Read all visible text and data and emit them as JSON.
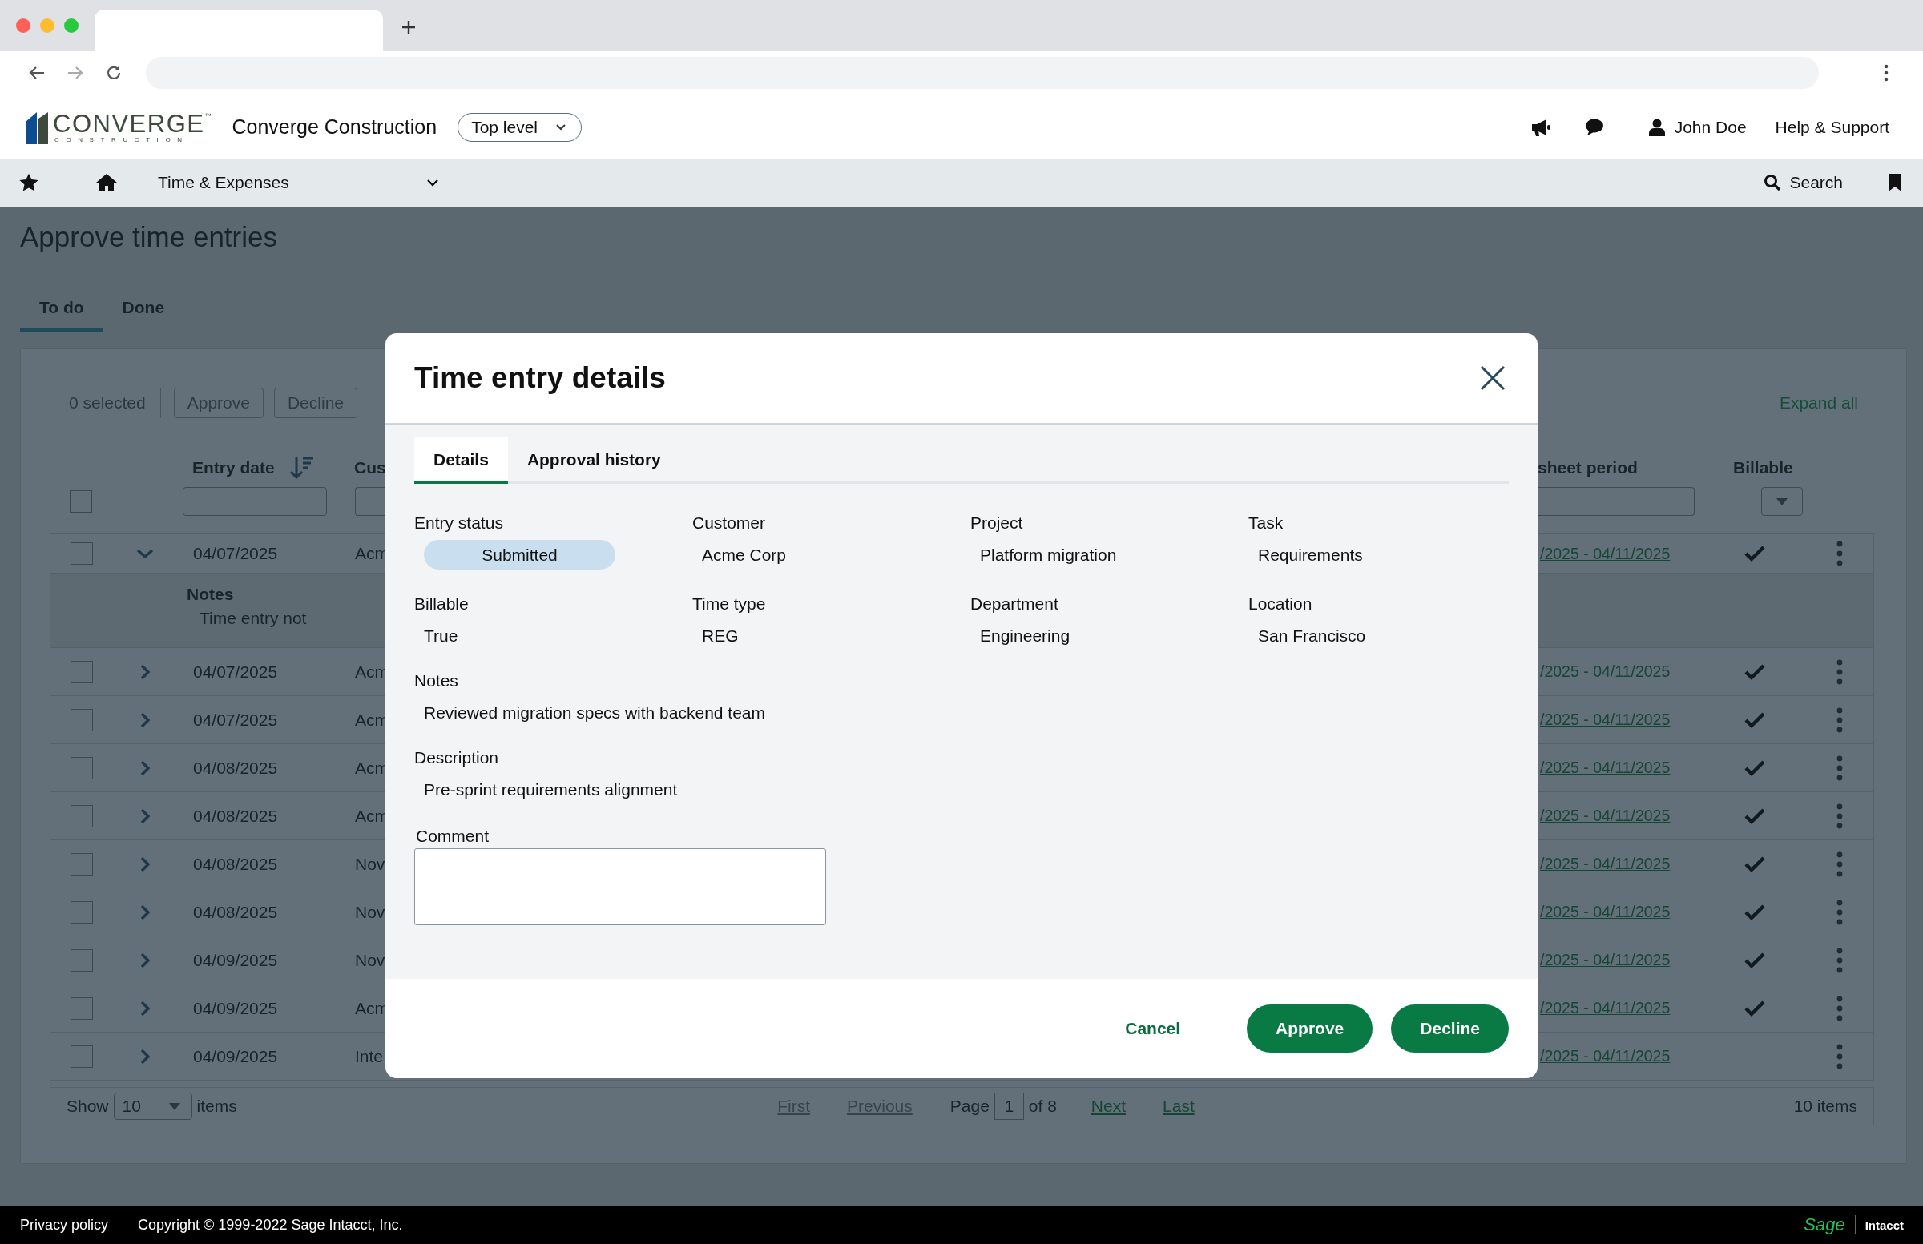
{
  "header": {
    "logo": {
      "name": "CONVERGE",
      "tagline": "CONSTRUCTION",
      "mark": "™"
    },
    "company": "Converge Construction",
    "level_button": "Top level",
    "user": "John Doe",
    "help": "Help & Support"
  },
  "nav": {
    "section": "Time & Expenses",
    "search": "Search"
  },
  "page": {
    "title": "Approve time entries",
    "tabs": [
      {
        "label": "To do",
        "selected": true
      },
      {
        "label": "Done",
        "selected": false
      }
    ],
    "toolbar": {
      "selected_count": "0 selected",
      "approve": "Approve",
      "decline": "Decline",
      "actions_disabled": true,
      "expand_all": "Expand all"
    }
  },
  "table": {
    "select_all_checked": false,
    "columns": [
      {
        "label": "Entry date",
        "sorted": true
      },
      {
        "label": "Cus"
      },
      {
        "label": "sheet period",
        "sorted": false
      },
      {
        "label": "Billable",
        "sorted": false
      }
    ],
    "rows": [
      {
        "checked": false,
        "expanded": true,
        "date": "04/07/2025",
        "customer": "Acm",
        "period": "/2025 - 04/11/2025",
        "billable": true,
        "notes": {
          "label": "Notes",
          "text": "Time entry not"
        }
      },
      {
        "checked": false,
        "expanded": false,
        "date": "04/07/2025",
        "customer": "Acm",
        "period": "/2025 - 04/11/2025",
        "billable": true
      },
      {
        "checked": false,
        "expanded": false,
        "date": "04/07/2025",
        "customer": "Acm",
        "period": "/2025 - 04/11/2025",
        "billable": true
      },
      {
        "checked": false,
        "expanded": false,
        "date": "04/08/2025",
        "customer": "Acm",
        "period": "/2025 - 04/11/2025",
        "billable": true
      },
      {
        "checked": false,
        "expanded": false,
        "date": "04/08/2025",
        "customer": "Acm",
        "period": "/2025 - 04/11/2025",
        "billable": true
      },
      {
        "checked": false,
        "expanded": false,
        "date": "04/08/2025",
        "customer": "Nov",
        "period": "/2025 - 04/11/2025",
        "billable": true
      },
      {
        "checked": false,
        "expanded": false,
        "date": "04/08/2025",
        "customer": "Nov",
        "period": "/2025 - 04/11/2025",
        "billable": true
      },
      {
        "checked": false,
        "expanded": false,
        "date": "04/09/2025",
        "customer": "Nov",
        "period": "/2025 - 04/11/2025",
        "billable": true
      },
      {
        "checked": false,
        "expanded": false,
        "date": "04/09/2025",
        "customer": "Acm",
        "period": "/2025 - 04/11/2025",
        "billable": true
      },
      {
        "checked": false,
        "expanded": false,
        "date": "04/09/2025",
        "customer": "Inte",
        "period": "/2025 - 04/11/2025",
        "billable": false
      }
    ]
  },
  "pager": {
    "show_label": "Show",
    "page_size": "10",
    "items_label": "items",
    "links": [
      {
        "label": "First",
        "disabled": true
      },
      {
        "label": "Previous",
        "disabled": true
      }
    ],
    "page_label": "Page",
    "page": "1",
    "of_label": "of 8",
    "links_after": [
      {
        "label": "Next",
        "disabled": false
      },
      {
        "label": "Last",
        "disabled": false
      }
    ],
    "total": "10 items"
  },
  "modal": {
    "title": "Time entry details",
    "tabs": [
      {
        "label": "Details",
        "selected": true
      },
      {
        "label": "Approval history",
        "selected": false
      }
    ],
    "fields": [
      {
        "label": "Entry status",
        "value": "Submitted",
        "kind": "status"
      },
      {
        "label": "Customer",
        "value": "Acme Corp",
        "kind": "text"
      },
      {
        "label": "Project",
        "value": "Platform migration",
        "kind": "text"
      },
      {
        "label": "Task",
        "value": "Requirements",
        "kind": "text"
      },
      {
        "label": "Billable",
        "value": "True",
        "kind": "text"
      },
      {
        "label": "Time type",
        "value": "REG",
        "kind": "text"
      },
      {
        "label": "Department",
        "value": "Engineering",
        "kind": "text"
      },
      {
        "label": "Location",
        "value": "San Francisco",
        "kind": "text"
      },
      {
        "label": "Notes",
        "value": "Reviewed migration specs with backend team",
        "kind": "wide"
      },
      {
        "label": "Description",
        "value": "Pre-sprint requirements alignment",
        "kind": "wide"
      }
    ],
    "comment_label": "Comment",
    "cancel": "Cancel",
    "approve": "Approve",
    "decline": "Decline"
  },
  "footer": {
    "privacy": "Privacy policy",
    "copyright": "Copyright © 1999-2022 Sage Intacct, Inc.",
    "brand": "Sage",
    "product": "Intacct"
  }
}
